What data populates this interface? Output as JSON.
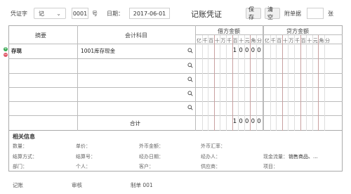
{
  "header": {
    "voucher_word_label": "凭证字",
    "voucher_word_value": "记",
    "voucher_number": "0001",
    "number_unit": "号",
    "date_label": "日期：",
    "date_value": "2017-06-01",
    "title": "记账凭证",
    "save_label": "保存",
    "clear_label": "清空",
    "attachments_label": "附单据",
    "attachments_unit": "张"
  },
  "table": {
    "col_summary": "摘要",
    "col_account": "会计科目",
    "col_debit": "借方金额",
    "col_credit": "贷方金额",
    "digit_headers": [
      "亿",
      "千",
      "百",
      "十",
      "万",
      "千",
      "百",
      "十",
      "元",
      "角",
      "分"
    ],
    "rows": [
      {
        "summary": "存现",
        "account": "1001库存现金",
        "debit": "10000",
        "credit": ""
      },
      {
        "summary": "",
        "account": "",
        "debit": "",
        "credit": ""
      },
      {
        "summary": "",
        "account": "",
        "debit": "",
        "credit": ""
      },
      {
        "summary": "",
        "account": "",
        "debit": "",
        "credit": ""
      },
      {
        "summary": "",
        "account": "",
        "debit": "",
        "credit": ""
      }
    ],
    "total_label": "合计",
    "total_debit": "10000",
    "total_credit": "",
    "add_row_icon_color": "#3aaa55",
    "remove_row_icon_color": "#e05a6a"
  },
  "info": {
    "title": "相关信息",
    "fields": [
      [
        "数量：",
        "单价：",
        "外币金额：",
        "外币汇率："
      ],
      [
        "结算方式：",
        "结算号：",
        "经办日期：",
        "经办人：",
        "现金流量："
      ],
      [
        "部门：",
        "个人：",
        "客户：",
        "供应商：",
        "项目："
      ]
    ],
    "cash_flow_value": "销售商品、..."
  },
  "footer": {
    "bookkeeper_label": "记账",
    "reviewer_label": "审核",
    "preparer_label": "制单 001"
  }
}
